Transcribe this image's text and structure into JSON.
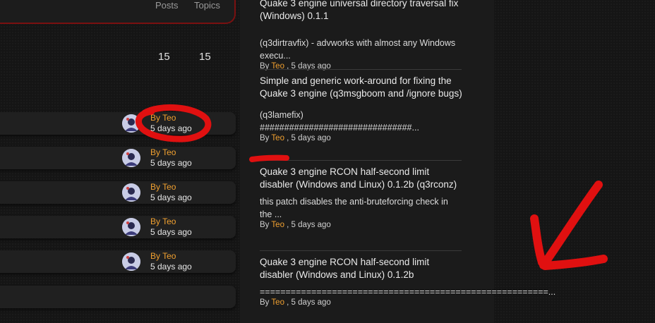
{
  "stats": {
    "posts_header": "Posts",
    "topics_header": "Topics",
    "posts_value": "15",
    "topics_value": "15"
  },
  "forum_rows": [
    {
      "by": "By Teo",
      "when": "5 days ago"
    },
    {
      "by": "By Teo",
      "when": "5 days ago"
    },
    {
      "by": "By Teo",
      "when": "5 days ago"
    },
    {
      "by": "By Teo",
      "when": "5 days ago"
    },
    {
      "by": "By Teo",
      "when": "5 days ago"
    }
  ],
  "activity": [
    {
      "title": "Quake 3 engine universal directory traversal fix (Windows) 0.1.1",
      "snippet_lines": [
        "(q3dirtravfix) - advworks with almost any Windows",
        "execu..."
      ],
      "by": "By",
      "author": "Teo",
      "time": ", 5 days ago"
    },
    {
      "title": "Simple and generic work-around for fixing the Quake 3 engine (q3msgboom and /ignore bugs)",
      "snippet_lines": [
        "(q3lamefix)",
        "###############################..."
      ],
      "by": "By",
      "author": "Teo",
      "time": ", 5 days ago"
    },
    {
      "title": "Quake 3 engine RCON half-second limit disabler (Windows and Linux) 0.1.2b (q3rconz)",
      "snippet_lines": [
        "this patch disables the anti-bruteforcing check in",
        "the ..."
      ],
      "by": "By",
      "author": "Teo",
      "time": ", 5 days ago"
    },
    {
      "title": "Quake 3 engine RCON half-second limit disabler (Windows and Linux) 0.1.2b",
      "snippet_lines": [
        "========================================================..."
      ],
      "by": "By",
      "author": "Teo",
      "time": ", 5 days ago"
    }
  ],
  "colors": {
    "accent_author": "#f0a030",
    "annotation_red": "#e01010",
    "card_border_red": "#7a1010"
  }
}
